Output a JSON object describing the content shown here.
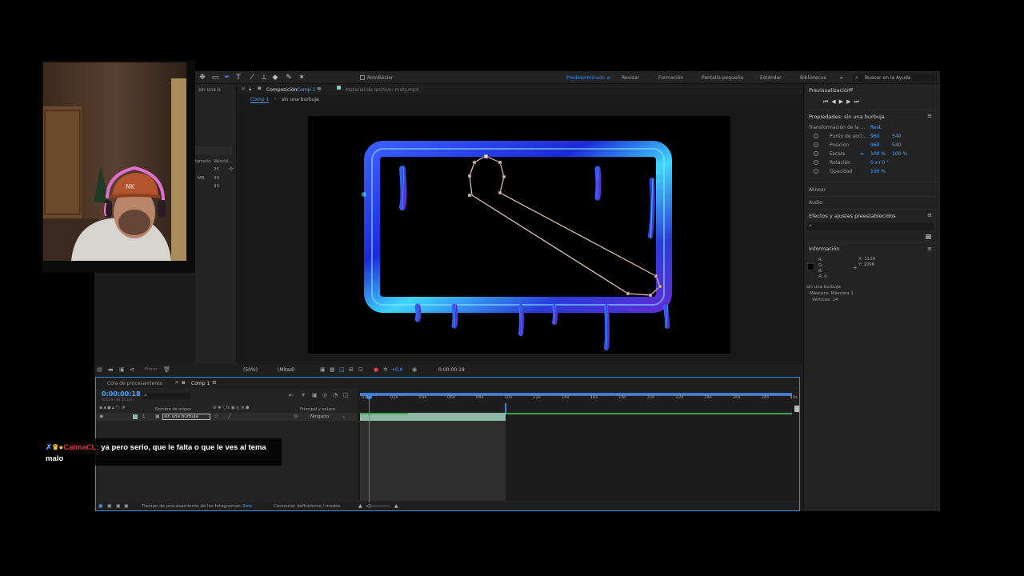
{
  "toolbar": {
    "rotobezier_label": "RotoBézier",
    "workspaces": [
      {
        "label": "Predeterminado",
        "active": true
      },
      {
        "label": "Revisar",
        "active": false
      },
      {
        "label": "Formación",
        "active": false
      },
      {
        "label": "Pantalla pequeña",
        "active": false
      },
      {
        "label": "Estándar",
        "active": false
      },
      {
        "label": "Bibliotecas",
        "active": false
      }
    ],
    "search_placeholder": "Buscar en la Ayuda"
  },
  "project_panel": {
    "tab_label": "sin una b",
    "col_tamano": "tamaño",
    "col_velocidad": "Velocid...",
    "rows": [
      {
        "size": "",
        "speed": "25"
      },
      {
        "size": "MB",
        "speed": "30"
      },
      {
        "size": "",
        "speed": "30"
      }
    ]
  },
  "composition": {
    "tab_prefix": "Composición",
    "tab_name": "Comp 1",
    "footage_tab": "Material de archivo: maty.mp4",
    "breadcrumb": [
      "Comp 1",
      "sin una burbuja"
    ],
    "zoom": "(50%)",
    "resolution": "(Mitad)",
    "exposure": "+0.0",
    "timecode": "0:00:00:18"
  },
  "preview": {
    "title": "Previsualización"
  },
  "properties": {
    "title": "Propiedades: sin una burbuja",
    "transform_label": "Transformación de la ...",
    "reset_label": "Rest.",
    "rows": [
      {
        "label": "Punto de ancl...",
        "v1": "960",
        "v2": "540"
      },
      {
        "label": "Posición",
        "v1": "960",
        "v2": "540"
      },
      {
        "label": "Escala",
        "v1": "100 %",
        "v2": "100 %"
      },
      {
        "label": "Rotación",
        "v1": "0 x+0 °",
        "v2": ""
      },
      {
        "label": "Opacidad",
        "v1": "100 %",
        "v2": ""
      }
    ]
  },
  "panels": {
    "align": "Alinear",
    "audio": "Audio",
    "effects": "Efectos y ajustes preestablecidos",
    "info": "Información"
  },
  "info": {
    "r": "R:",
    "g": "G:",
    "b": "B:",
    "a": "A:  0",
    "x": "X:  1128",
    "y": "Y:  1096",
    "layer": "sin una burbuja",
    "mask": "Máscara: Máscara 1",
    "vertices": "Vértices: 14"
  },
  "timeline": {
    "tab_queue": "Cola de procesamiento",
    "tab_comp": "Comp 1",
    "timecode": "0:00:00:18",
    "frame_info": "00018 (30.00 fps)",
    "col_source": "Nombre de origen",
    "col_parent": "Principal y enlace",
    "layer_number": "1",
    "layer_name": "sin una burbuja",
    "parent_value": "Ninguno",
    "ticks": [
      "00s",
      "02s",
      "04s",
      "06s",
      "08s",
      "10s",
      "12s",
      "14s",
      "16s",
      "18s",
      "20s",
      "22s",
      "24s",
      "26s",
      "28s",
      "30s"
    ],
    "render_time_label": "Tiempo de procesamiento de los fotogramas:",
    "render_time_value": "2ms",
    "switch_label": "Conmutar definidores / modos"
  },
  "viewer_bar": {
    "filter_label": "Filtrar"
  },
  "chat": {
    "username": "CalmaCL:",
    "message": "ya pero serio, que le falta o que le ves al tema malo"
  },
  "colors": {
    "accent": "#2d8ceb",
    "panel": "#232323",
    "layer": "#8fb7a7",
    "chat_user": "#e0314a"
  }
}
